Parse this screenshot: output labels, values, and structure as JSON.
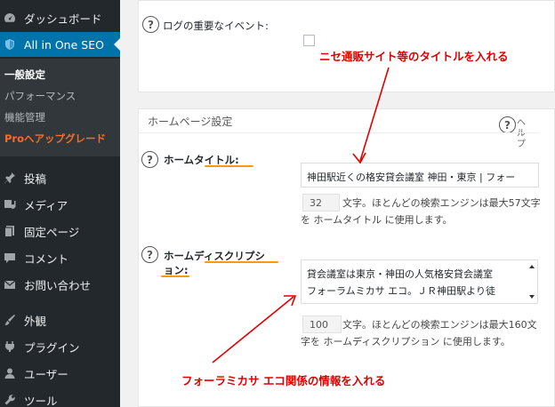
{
  "sidebar": {
    "items": [
      {
        "label": "ダッシュボード",
        "icon": "dashboard-icon"
      },
      {
        "label": "All in One SEO",
        "icon": "shield-icon"
      },
      {
        "label": "投稿",
        "icon": "pin-icon"
      },
      {
        "label": "メディア",
        "icon": "media-icon"
      },
      {
        "label": "固定ページ",
        "icon": "page-icon"
      },
      {
        "label": "コメント",
        "icon": "comment-icon"
      },
      {
        "label": "お問い合わせ",
        "icon": "mail-icon"
      },
      {
        "label": "外観",
        "icon": "brush-icon"
      },
      {
        "label": "プラグイン",
        "icon": "plugin-icon"
      },
      {
        "label": "ユーザー",
        "icon": "user-icon"
      },
      {
        "label": "ツール",
        "icon": "wrench-icon"
      }
    ],
    "submenu": [
      {
        "label": "一般設定"
      },
      {
        "label": "パフォーマンス"
      },
      {
        "label": "機能管理"
      },
      {
        "label": "Proへアップグレード"
      }
    ]
  },
  "log_section": {
    "label": "ログの重要なイベント:"
  },
  "home_section": {
    "title": "ホームページ設定",
    "help_label": "ヘルプ",
    "home_title": {
      "label": "ホームタイトル:",
      "value": "神田駅近くの格安貸会議室 神田・東京 | フォー",
      "count": "32",
      "counter_line1": "文字。ほとんどの検索エンジンは最大57文字",
      "counter_line2": "を ホームタイトル に使用します。"
    },
    "home_description": {
      "label_line1": "ホームディスクリプシ",
      "label_line2": "ョン:",
      "value_line1": "貸会議室は東京・神田の人気格安貸会議室",
      "value_line2": "フォーラムミカサ エコ。ＪＲ神田駅より徒",
      "count": "100",
      "counter_line1": "文字。ほとんどの検索エンジンは最大160文",
      "counter_line2": "字を ホームディスクリプション に使用します。"
    }
  },
  "annotations": {
    "top": "ニセ通販サイト等のタイトルを入れる",
    "bottom": "フォーラミカサ エコ関係の情報を入れる"
  },
  "colors": {
    "sidebar_bg": "#23282d",
    "submenu_bg": "#32373c",
    "active_bg": "#0073aa",
    "upgrade": "#f56e28",
    "annotation": "#e00000",
    "underline": "#f39c12"
  }
}
